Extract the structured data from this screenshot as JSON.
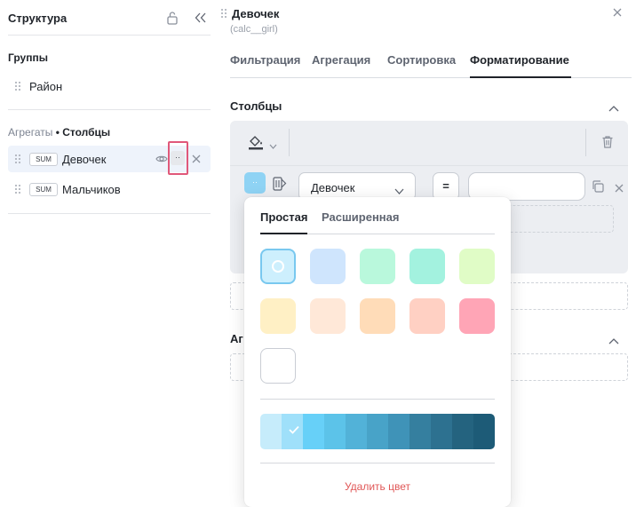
{
  "left": {
    "title": "Структура",
    "groups_title": "Группы",
    "groups": [
      {
        "label": "Район"
      }
    ],
    "aggregates_title_prefix": "Агрегаты",
    "aggregates_title_bullet": "•",
    "aggregates_title_suffix": "Столбцы",
    "aggregates": [
      {
        "badge": "SUM",
        "label": "Девочек"
      },
      {
        "badge": "SUM",
        "label": "Мальчиков"
      }
    ],
    "more_label": "··"
  },
  "right": {
    "title": "Девочек",
    "subtitle": "(calc__girl)",
    "tabs": [
      "Фильтрация",
      "Агрегация",
      "Сортировка",
      "Форматирование"
    ],
    "active_tab": "Форматирование",
    "columns_title": "Столбцы",
    "swatch_label": "··",
    "field_select": "Девочек",
    "operator": "=",
    "value": "",
    "aggregates_title": "Аг"
  },
  "popup": {
    "tabs": [
      "Простая",
      "Расширенная"
    ],
    "active_tab": "Простая",
    "swatches": [
      "#cdeffd",
      "#cfe5fd",
      "#b9f8dc",
      "#a3f2df",
      "#e0fcc6",
      "#fff0c5",
      "#ffe8d8",
      "#ffdcb8",
      "#ffd0c3",
      "#ffa5b6",
      "#ffffff"
    ],
    "selected_swatch_index": 0,
    "gradient": [
      "#c6ecfb",
      "#9fe0fa",
      "#67d0f8",
      "#5cc3e9",
      "#52b2d8",
      "#48a3c8",
      "#3f93b8",
      "#357f9f",
      "#2d7190",
      "#24637f",
      "#1d5b77"
    ],
    "selected_gradient_index": 1,
    "remove_label": "Удалить цвет"
  }
}
